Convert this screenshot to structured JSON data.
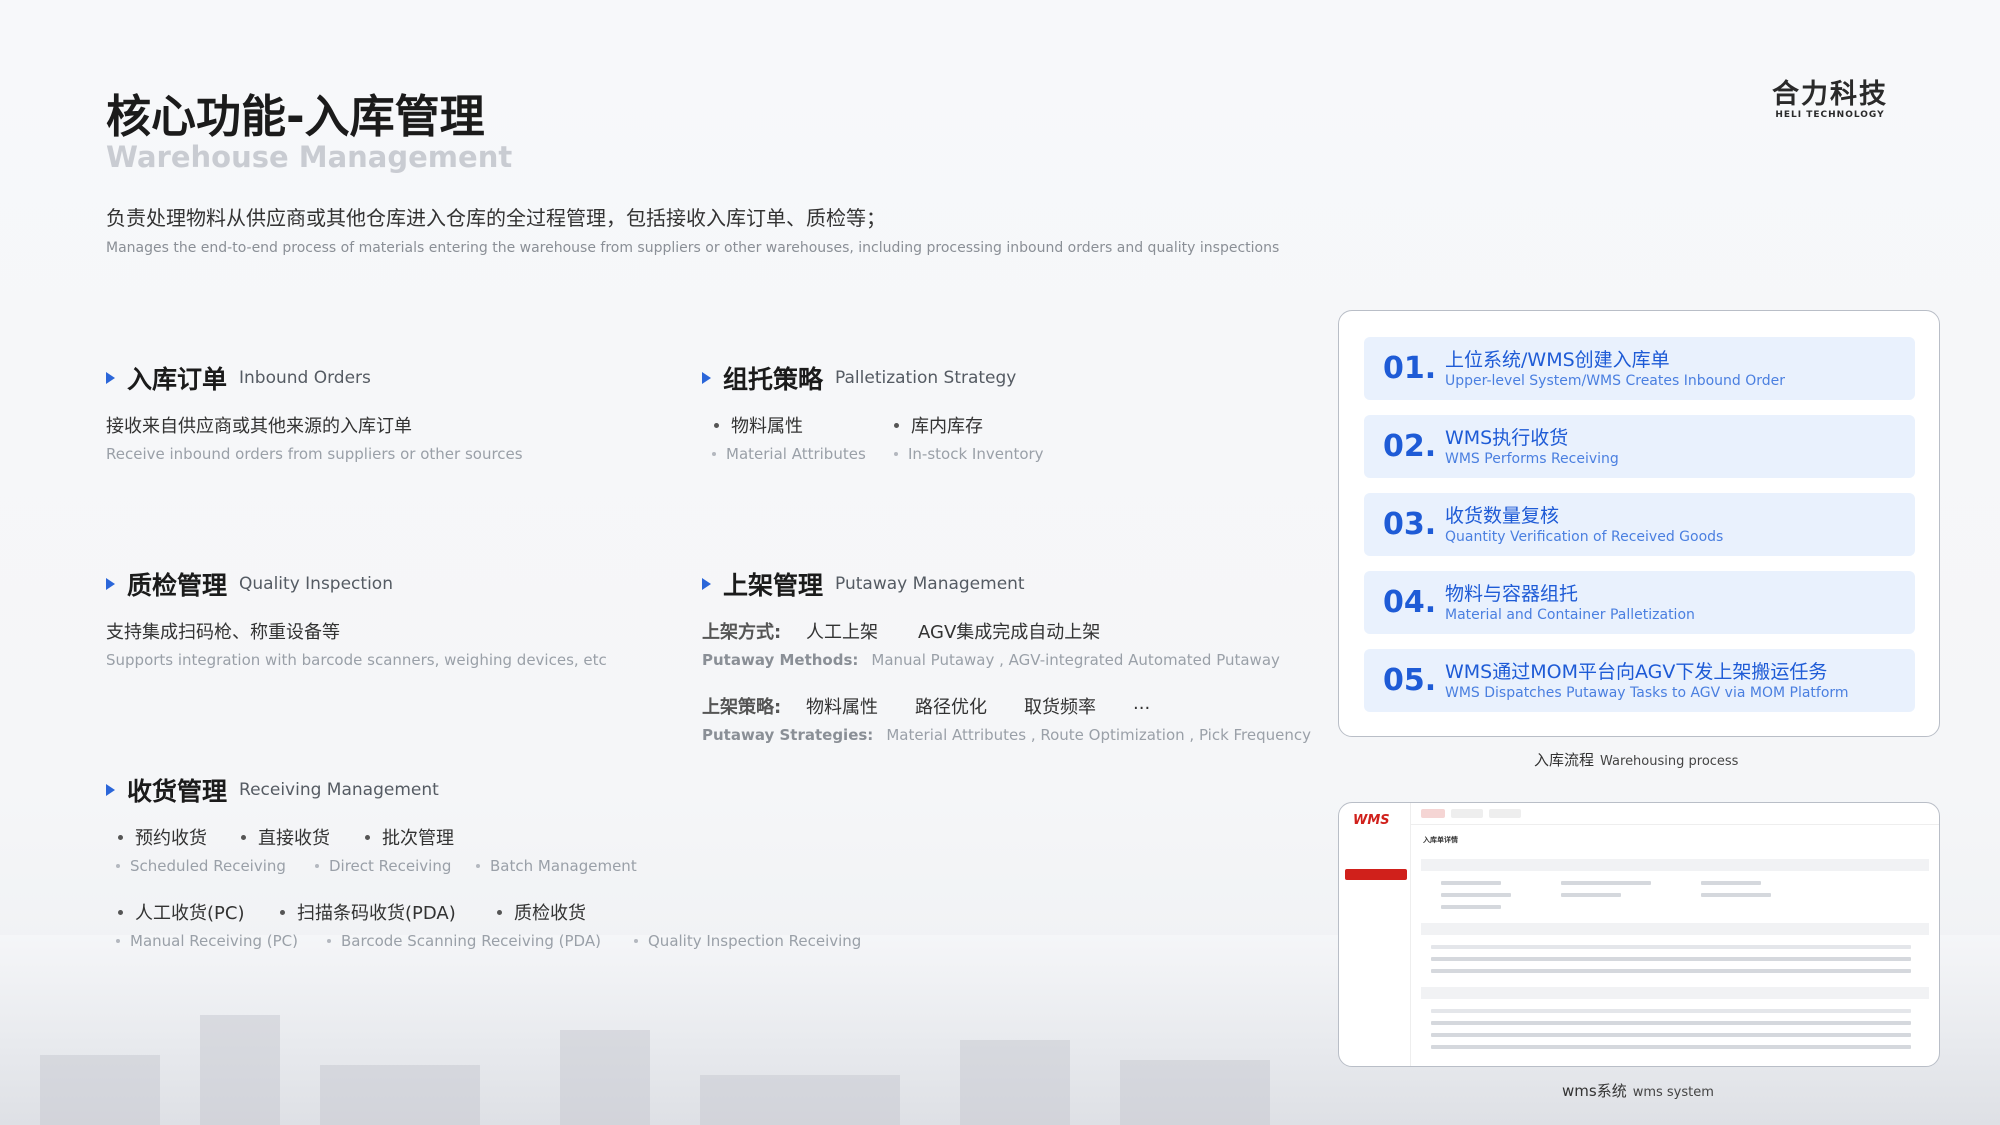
{
  "header": {
    "title_cn": "核心功能-入库管理",
    "title_en": "Warehouse Management",
    "logo_cn": "合力科技",
    "logo_en": "HELI TECHNOLOGY",
    "desc_cn": "负责处理物料从供应商或其他仓库进入仓库的全过程管理，包括接收入库订单、质检等；",
    "desc_en": "Manages the end-to-end process of materials entering the warehouse from suppliers or other warehouses, including processing inbound orders and quality inspections"
  },
  "inbound": {
    "title_cn": "入库订单",
    "title_en": "Inbound Orders",
    "text_cn": "接收来自供应商或其他来源的入库订单",
    "text_en": "Receive inbound orders from suppliers or other sources"
  },
  "palletization": {
    "title_cn": "组托策略",
    "title_en": "Palletization Strategy",
    "items_cn": [
      "物料属性",
      "库内库存"
    ],
    "items_en": [
      "Material Attributes",
      "In-stock Inventory"
    ]
  },
  "quality": {
    "title_cn": "质检管理",
    "title_en": "Quality Inspection",
    "text_cn": "支持集成扫码枪、称重设备等",
    "text_en": "Supports integration with barcode scanners, weighing devices, etc"
  },
  "putaway": {
    "title_cn": "上架管理",
    "title_en": "Putaway Management",
    "methods_label_cn": "上架方式:",
    "methods_cn": [
      "人工上架",
      "AGV集成完成自动上架"
    ],
    "methods_label_en": "Putaway Methods:",
    "methods_en": "Manual Putaway , AGV-integrated Automated Putaway",
    "strategies_label_cn": "上架策略:",
    "strategies_cn": [
      "物料属性",
      "路径优化",
      "取货频率",
      "..."
    ],
    "strategies_label_en": "Putaway Strategies:",
    "strategies_en": "Material Attributes , Route Optimization , Pick Frequency"
  },
  "receiving": {
    "title_cn": "收货管理",
    "title_en": "Receiving Management",
    "row1_cn": [
      "预约收货",
      "直接收货",
      "批次管理"
    ],
    "row1_en": [
      "Scheduled Receiving",
      "Direct Receiving",
      "Batch Management"
    ],
    "row2_cn": [
      "人工收货(PC)",
      "扫描条码收货(PDA)",
      "质检收货"
    ],
    "row2_en": [
      "Manual Receiving (PC)",
      "Barcode Scanning Receiving (PDA)",
      "Quality Inspection Receiving"
    ]
  },
  "process": {
    "steps": [
      {
        "num": "01.",
        "cn": "上位系统/WMS创建入库单",
        "en": "Upper-level System/WMS Creates Inbound Order"
      },
      {
        "num": "02.",
        "cn": "WMS执行收货",
        "en": "WMS Performs Receiving"
      },
      {
        "num": "03.",
        "cn": "收货数量复核",
        "en": "Quantity Verification of Received Goods"
      },
      {
        "num": "04.",
        "cn": "物料与容器组托",
        "en": "Material and Container Palletization"
      },
      {
        "num": "05.",
        "cn": "WMS通过MOM平台向AGV下发上架搬运任务",
        "en": "WMS Dispatches Putaway Tasks to AGV via MOM Platform"
      }
    ],
    "caption_cn": "入库流程",
    "caption_en": "Warehousing process"
  },
  "wms": {
    "logo": "WMS",
    "page_title": "入库单详情",
    "caption_cn": "wms系统",
    "caption_en": "wms system"
  }
}
